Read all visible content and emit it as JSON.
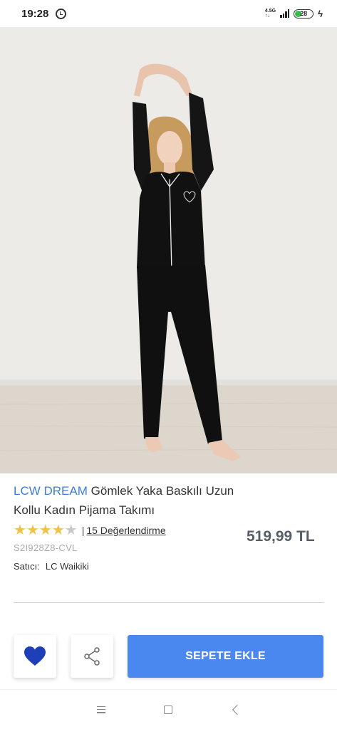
{
  "status_bar": {
    "time": "19:28",
    "network_top": "4.5G",
    "network_bottom": "↑↓",
    "battery": "28"
  },
  "product": {
    "brand": "LCW DREAM",
    "name": "Gömlek Yaka Baskılı Uzun Kollu Kadın Pijama Takımı",
    "price": "519,99 TL",
    "rating_value": 4,
    "rating_max": 5,
    "rating_separator": "|",
    "review_count_label": "15 Değerlendirme",
    "sku": "S2I928Z8-CVL",
    "seller_label": "Satıcı:",
    "seller_name": "LC Waikiki"
  },
  "actions": {
    "favorite_icon": "heart-icon",
    "share_icon": "share-icon",
    "add_to_cart_label": "SEPETE EKLE",
    "accent_color": "#4a88f0",
    "heart_color": "#1f3fb8"
  },
  "nav_bar": {
    "icons": [
      "menu-icon",
      "home-icon",
      "back-icon"
    ]
  }
}
